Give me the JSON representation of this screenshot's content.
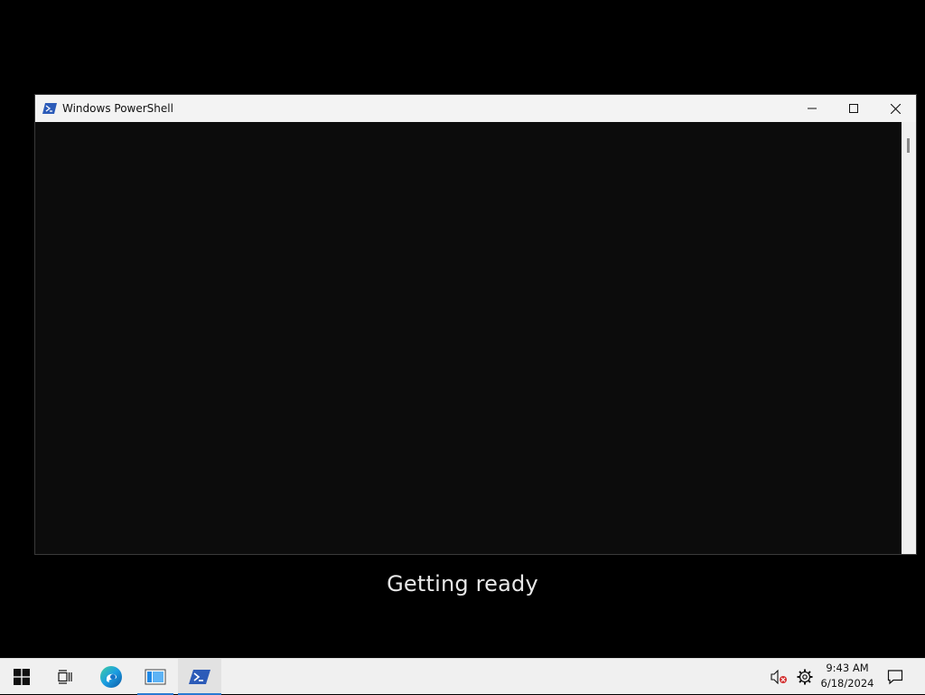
{
  "window": {
    "title": "Windows PowerShell"
  },
  "status": {
    "text": "Getting ready"
  },
  "taskbar": {
    "apps": [
      "start-icon",
      "task-view-icon",
      "edge-icon",
      "file-explorer-icon",
      "powershell-icon"
    ],
    "clock": {
      "time": "9:43 AM",
      "date": "6/18/2024"
    }
  },
  "colors": {
    "desktop": "#000000",
    "console_bg": "#0c0c0c",
    "titlebar_bg": "#f3f3f3",
    "taskbar_bg": "#f0f0f0",
    "accent": "#2a7ad2",
    "powershell_blue": "#2c5bb8"
  }
}
